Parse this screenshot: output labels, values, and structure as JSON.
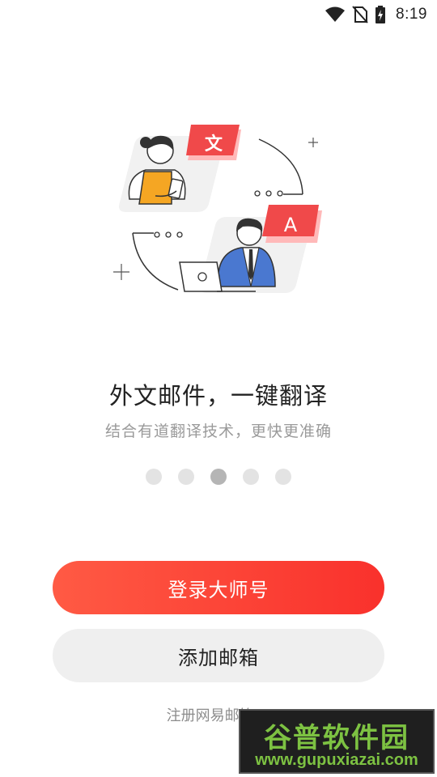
{
  "status_bar": {
    "time": "8:19",
    "icons": [
      "wifi-icon",
      "no-sim-icon",
      "battery-charging-icon"
    ]
  },
  "illustration": {
    "chinese_card_text": "文",
    "latin_card_text": "A",
    "accent_color": "#f0494a"
  },
  "onboarding": {
    "headline": "外文邮件，一键翻译",
    "subline": "结合有道翻译技术，更快更准确",
    "page_count": 5,
    "active_page": 3
  },
  "buttons": {
    "login_label": "登录大师号",
    "add_mailbox_label": "添加邮箱"
  },
  "register_link": "注册网易邮箱 >",
  "watermark": {
    "line1": "谷普软件园",
    "line2": "www.gupuxiazai.com"
  },
  "colors": {
    "primary_gradient_start": "#ff5a44",
    "primary_gradient_end": "#f9312c",
    "secondary_bg": "#efefef"
  }
}
